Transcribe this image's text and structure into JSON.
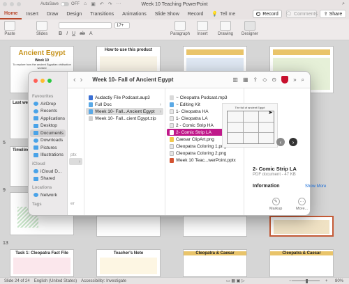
{
  "app": {
    "window_title": "Week 10 Teaching PowerPoint",
    "autosave_label": "AutoSave",
    "autosave_state": "OFF",
    "tabs": [
      "Home",
      "Insert",
      "Draw",
      "Design",
      "Transitions",
      "Animations",
      "Slide Show",
      "Record"
    ],
    "active_tab": "Home",
    "tell_me": "Tell me",
    "record_button": "Record",
    "comments_button": "Comments",
    "share_button": "Share"
  },
  "ribbon": {
    "paste": "Paste",
    "slides": "Slides",
    "font_size": "17+",
    "paragraph": "Paragraph",
    "insert": "Insert",
    "drawing": "Drawing",
    "designer": "Designer"
  },
  "slides": {
    "slide_numbers": [
      "5",
      "9",
      "13"
    ],
    "s1_title": "Ancient Egypt",
    "s1_week": "Week 10",
    "s1_sub": "To explore how the ancient Egyptian civilisation worked",
    "s2_title": "How to use this product",
    "s_lesson1": "Last week",
    "s_timeline": "Timeline",
    "s_task": "Task 1: Cleopatra Fact File",
    "s_teacher": "Teacher's Note",
    "s_cleo1": "Cleopatra & Caesar",
    "s_cleo2": "Cleopatra & Caesar"
  },
  "finder": {
    "title": "Week 10- Fall of Ancient Egypt",
    "sidebar": {
      "favourites_label": "Favourites",
      "favourites": [
        "AirDrop",
        "Recents",
        "Applications",
        "Desktop",
        "Documents",
        "Downloads",
        "Pictures",
        "Illustrations"
      ],
      "active": "Documents",
      "icloud_label": "iCloud",
      "icloud": [
        "iCloud D...",
        "Shared"
      ],
      "locations_label": "Locations",
      "locations": [
        "Network"
      ],
      "tags_label": "Tags"
    },
    "col1_fragments": [
      "ptx",
      "er"
    ],
    "col2": [
      "Audactiy File Podcast.aup3",
      "Full Doc",
      "Week 10- Fall...Ancient Egypt",
      "Week 10- Fall...cient Egypt.zip"
    ],
    "col3": [
      "~ Cleopatra Podcast.mp3",
      "~ Editing Kit",
      "1- Cleopatra HA",
      "1- Cleopatra LA",
      "2 - Comic Strip HA",
      "2- Comic Strip LA",
      "Caesar ClipArt.png",
      "Cleopatra Coloring 1.png",
      "Cleopatra Coloring 2.png",
      "Week 10 Teac...werPoint.pptx"
    ],
    "preview": {
      "thumb_title": "The fall of ancient Egypt",
      "name": "2- Comic Strip LA",
      "meta": "PDF document - 47 KB",
      "info_label": "Information",
      "show_more": "Show More",
      "markup": "Markup",
      "more": "More..."
    }
  },
  "status": {
    "slide_indicator": "Slide 24 of 24",
    "language": "English (United States)",
    "accessibility": "Accessibility: Investigate",
    "zoom": "80%",
    "zoom_fraction": 0.52
  },
  "colors": {
    "accent": "#b7472a",
    "selection_pink": "#c0198a",
    "egypt_gold": "#c6921b",
    "finder_red": "#c8102e"
  }
}
